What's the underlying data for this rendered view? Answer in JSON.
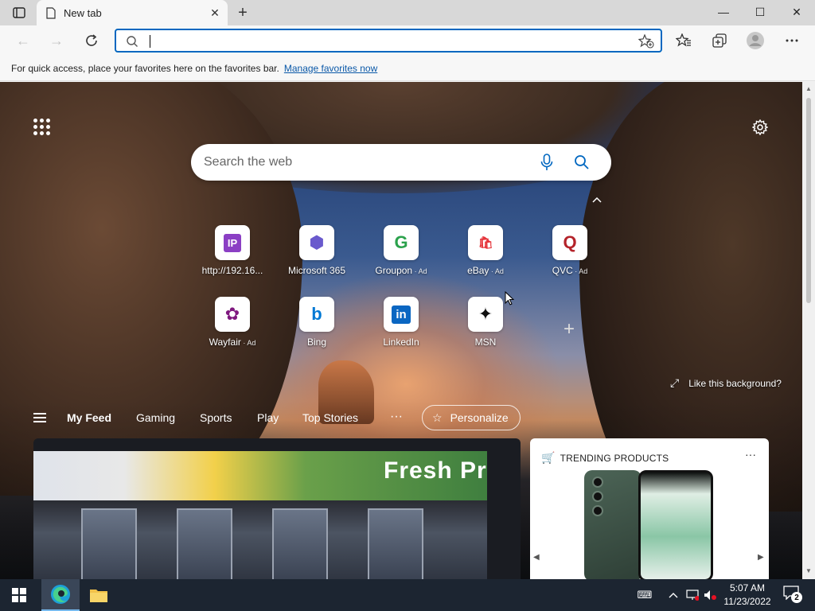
{
  "window": {
    "tab_title": "New tab",
    "tab_close": "✕",
    "new_tab": "+",
    "minimize": "—",
    "maximize": "☐",
    "close": "✕"
  },
  "toolbar": {
    "back": "←",
    "forward": "→",
    "address_value": "",
    "address_placeholder": ""
  },
  "favorites_bar": {
    "message": "For quick access, place your favorites here on the favorites bar.",
    "link": "Manage favorites now"
  },
  "search": {
    "placeholder": "Search the web"
  },
  "tiles": [
    {
      "label": "http://192.16...",
      "ad": "",
      "icon": "ip-icon",
      "glyph": "IP",
      "color": "#8b3fc4"
    },
    {
      "label": "Microsoft 365",
      "ad": "",
      "icon": "microsoft-365-icon",
      "glyph": "⬢",
      "color": "#6a5acd"
    },
    {
      "label": "Groupon",
      "ad": " · Ad",
      "icon": "groupon-icon",
      "glyph": "G",
      "color": "#2ba24c"
    },
    {
      "label": "eBay",
      "ad": " · Ad",
      "icon": "ebay-icon",
      "glyph": "🛍",
      "color": "#e53238"
    },
    {
      "label": "QVC",
      "ad": " · Ad",
      "icon": "qvc-icon",
      "glyph": "Q",
      "color": "#b4232a"
    },
    {
      "label": "Wayfair",
      "ad": " · Ad",
      "icon": "wayfair-icon",
      "glyph": "✿",
      "color": "#7f187f"
    },
    {
      "label": "Bing",
      "ad": "",
      "icon": "bing-icon",
      "glyph": "b",
      "color": "#0078d4"
    },
    {
      "label": "LinkedIn",
      "ad": "",
      "icon": "linkedin-icon",
      "glyph": "in",
      "color": "#0a66c2"
    },
    {
      "label": "MSN",
      "ad": "",
      "icon": "msn-icon",
      "glyph": "✦",
      "color": "#111111"
    }
  ],
  "add_tile": "+",
  "background": {
    "like_text": "Like this background?"
  },
  "feed": {
    "tabs": [
      "My Feed",
      "Gaming",
      "Sports",
      "Play",
      "Top Stories"
    ],
    "more": "···",
    "personalize": "Personalize"
  },
  "news_card": {
    "sign_text": "Fresh Pr"
  },
  "trending": {
    "title": "TRENDING PRODUCTS",
    "more": "···",
    "prev": "◀",
    "next": "▶"
  },
  "taskbar": {
    "time": "5:07 AM",
    "date": "11/23/2022",
    "notification_count": "2"
  },
  "colors": {
    "accent": "#0067c0",
    "taskbar": "#1c2531"
  }
}
